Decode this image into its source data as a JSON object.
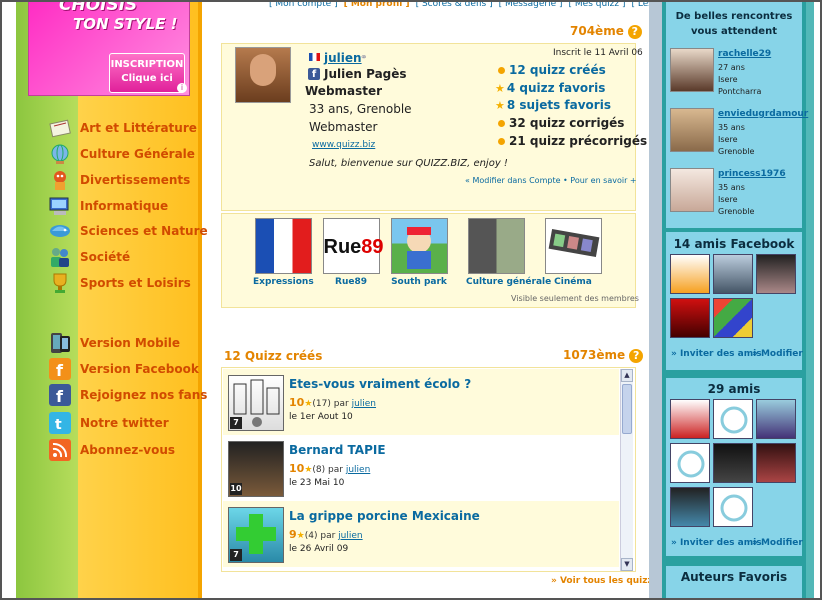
{
  "banner": {
    "line1": "CHOISIS",
    "line2": "TON STYLE !",
    "button_line1": "INSCRIPTION",
    "button_line2": "Clique ici",
    "info": "i"
  },
  "categories": [
    {
      "label": "Art et Littérature",
      "icon": "art-icon"
    },
    {
      "label": "Culture Générale",
      "icon": "globe-icon"
    },
    {
      "label": "Divertissements",
      "icon": "entertainment-icon"
    },
    {
      "label": "Informatique",
      "icon": "computer-icon"
    },
    {
      "label": "Sciences et Nature",
      "icon": "nature-icon"
    },
    {
      "label": "Société",
      "icon": "people-icon"
    },
    {
      "label": "Sports et Loisirs",
      "icon": "trophy-icon"
    }
  ],
  "extras": [
    {
      "label": "Version Mobile",
      "icon": "mobile-icon"
    },
    {
      "label": "Version Facebook",
      "icon": "facebook-icon"
    },
    {
      "label": "Rejoignez nos fans",
      "icon": "facebook-icon"
    },
    {
      "label": "Notre twitter",
      "icon": "twitter-icon"
    },
    {
      "label": "Abonnez-vous",
      "icon": "rss-icon"
    }
  ],
  "topnav": [
    "[ Mon compte ]",
    "[ Mon profil ]",
    "[ Scores & défis ]",
    "[ Messagerie ]",
    "[ Mes quizz ]",
    "[ Les services + ]"
  ],
  "profile": {
    "rank": "704ème",
    "username": "julien",
    "fullname": "Julien Pagès",
    "title": "Webmaster",
    "age_city": "33 ans, Grenoble",
    "job": "Webmaster",
    "website": "www.quizz.biz",
    "welcome": "Salut, bienvenue sur QUIZZ.BIZ, enjoy !",
    "joined": "Inscrit le 11 Avril 06",
    "modify": "« Modifier dans Compte • Pour en savoir +",
    "stats": {
      "created": "12 quizz créés",
      "favorites": "4 quizz favoris",
      "subjects": "8 sujets favoris",
      "corrected": "32 quizz corrigés",
      "precorrected": "21 quizz précorrigés"
    }
  },
  "favorites": [
    {
      "label": "Expressions",
      "image": "french-flag"
    },
    {
      "label": "Rue89",
      "image": "rue89-logo"
    },
    {
      "label": "South park",
      "image": "south-park"
    },
    {
      "label": "Culture générale",
      "image": "collage"
    },
    {
      "label": "Cinéma",
      "image": "film-strip"
    }
  ],
  "members_only": "Visible seulement des membres",
  "quizzes": {
    "title": "12 Quizz créés",
    "rank": "1073ème",
    "see_all": "» Voir tous les quizz",
    "items": [
      {
        "title": "Etes-vous vraiment écolo ?",
        "score": "10",
        "votes": "(17)",
        "by": "par",
        "author": "julien",
        "date": "le 1er Aout 10",
        "level": "7"
      },
      {
        "title": "Bernard TAPIE",
        "score": "10",
        "votes": "(8)",
        "by": "par",
        "author": "julien",
        "date": "le 23 Mai 10",
        "level": "10"
      },
      {
        "title": "La grippe porcine Mexicaine",
        "score": "9",
        "votes": "(4)",
        "by": "par",
        "author": "julien",
        "date": "le 26 Avril 09",
        "level": "7"
      }
    ]
  },
  "sidebar": {
    "meet_title": "De belles rencontres vous attendent",
    "members": [
      {
        "name": "rachelle29",
        "age": "27 ans",
        "region": "Isere",
        "city": "Pontcharra"
      },
      {
        "name": "enviedugrdamour",
        "age": "35 ans",
        "region": "Isere",
        "city": "Grenoble"
      },
      {
        "name": "princess1976",
        "age": "35 ans",
        "region": "Isere",
        "city": "Grenoble"
      }
    ],
    "fb_title": "14 amis Facebook",
    "invite": "» Inviter des amis",
    "modify": "» Modifier",
    "friends_title": "29 amis",
    "authors_title": "Auteurs Favoris"
  },
  "colors": {
    "accent": "#e38400",
    "link": "#0a6aa0",
    "sidebar": "#87d4e8"
  }
}
